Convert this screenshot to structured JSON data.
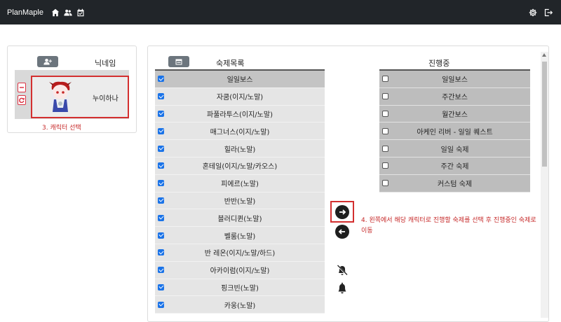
{
  "app": {
    "brand": "PlanMaple",
    "nav_icons": [
      "home-icon",
      "users-icon",
      "calendar-check-icon"
    ],
    "right_icons": [
      "gear-icon",
      "logout-icon"
    ]
  },
  "character_panel": {
    "add_icon": "user-plus-icon",
    "nickname_header": "닉네임",
    "character": {
      "name": "누이하나",
      "avatar": "chibi-character-avatar"
    },
    "side_buttons": [
      "minus-icon",
      "refresh-icon"
    ],
    "annotation": "3. 캐릭터 선택"
  },
  "task_panel": {
    "calendar_icon": "calendar-icon",
    "list_title": "숙제목록",
    "progress_title": "진행중",
    "task_list": [
      {
        "label": "일일보스",
        "checked": true
      },
      {
        "label": "자쿰(이지/노말)",
        "checked": true
      },
      {
        "label": "파풀라투스(이지/노말)",
        "checked": true
      },
      {
        "label": "매그너스(이지/노말)",
        "checked": true
      },
      {
        "label": "힐라(노말)",
        "checked": true
      },
      {
        "label": "혼테일(이지/노말/카오스)",
        "checked": true
      },
      {
        "label": "피에르(노말)",
        "checked": true
      },
      {
        "label": "반반(노말)",
        "checked": true
      },
      {
        "label": "블러디퀸(노말)",
        "checked": true
      },
      {
        "label": "벨룸(노말)",
        "checked": true
      },
      {
        "label": "반 레온(이지/노말/하드)",
        "checked": true
      },
      {
        "label": "아카이럼(이지/노말)",
        "checked": true
      },
      {
        "label": "핑크빈(노말)",
        "checked": true
      },
      {
        "label": "카웅(노말)",
        "checked": true
      }
    ],
    "in_progress": [
      {
        "label": "일일보스",
        "checked": false
      },
      {
        "label": "주간보스",
        "checked": false
      },
      {
        "label": "월간보스",
        "checked": false
      },
      {
        "label": "아케인 리버 - 일일 퀘스트",
        "checked": false
      },
      {
        "label": "일일 숙제",
        "checked": false
      },
      {
        "label": "주간 숙제",
        "checked": false
      },
      {
        "label": "커스텀 숙제",
        "checked": false
      }
    ],
    "move_right_icon": "arrow-right-circle-icon",
    "move_left_icon": "arrow-left-circle-icon",
    "annotation": "4. 왼쪽에서 해당 캐릭터로 진행할 숙제를 선택 후 진행중인 숙제로 이동",
    "bell_off_icon": "bell-slash-icon",
    "bell_icon": "bell-icon"
  }
}
